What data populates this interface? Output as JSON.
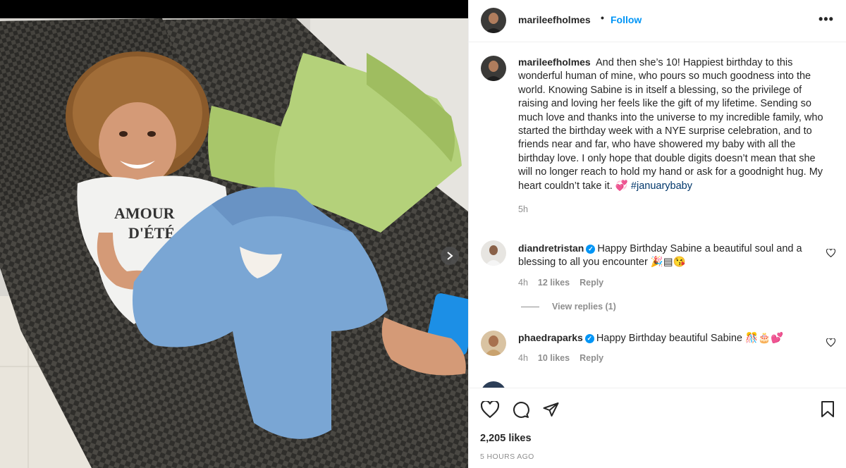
{
  "post": {
    "username": "marileefholmes",
    "follow_label": "Follow",
    "dot": "•",
    "more_label": "•••"
  },
  "caption": {
    "username": "marileefholmes",
    "text": "And then she’s 10! Happiest birthday to this wonderful human of mine, who pours so much goodness into the world. Knowing Sabine is in itself a blessing, so the privilege of raising and loving her feels like the gift of my lifetime. Sending so much love and thanks into the universe to my incredible family, who started the birthday week with a NYE surprise celebration, and to friends near and far, who have showered my baby with all the birthday love. I only hope that double digits doesn’t mean that she will no longer reach to hold my hand or ask for a goodnight hug. My heart couldn’t take it. 💞",
    "hashtag": "#januarybaby",
    "time": "5h"
  },
  "photo": {
    "shirt_line1": "AMOUR",
    "shirt_line2": "D'ÉTÉ"
  },
  "comments": [
    {
      "username": "diandretristan",
      "text": "Happy Birthday Sabine a beautiful soul and a blessing to all you encounter 🎉▤😘",
      "time": "4h",
      "likes": "12 likes",
      "reply": "Reply"
    },
    {
      "username": "phaedraparks",
      "text": "Happy Birthday beautiful Sabine 🎊🎂💕",
      "time": "4h",
      "likes": "10 likes",
      "reply": "Reply"
    }
  ],
  "view_replies": "View replies (1)",
  "likes_count": "2,205 likes",
  "posted_ago": "5 HOURS AGO",
  "colors": {
    "link": "#0095f6",
    "hashtag": "#00376b",
    "muted": "#8e8e8e"
  }
}
